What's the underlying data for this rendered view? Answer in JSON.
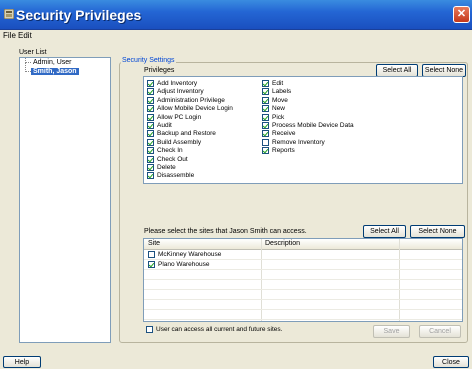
{
  "window": {
    "title": "Security Privileges",
    "close_glyph": "✕"
  },
  "menu": [
    {
      "label": "File",
      "hotkey": "F"
    },
    {
      "label": "Edit",
      "hotkey": "E"
    }
  ],
  "user_list": {
    "label": "User List",
    "users": [
      {
        "name": "Admin, User",
        "selected": false
      },
      {
        "name": "Smith, Jason",
        "selected": true
      }
    ]
  },
  "security_settings": {
    "legend": "Security Settings",
    "privileges_label": "Privileges",
    "select_all": "Select All",
    "select_none": "Select None",
    "privileges_col1": [
      {
        "label": "Add Inventory",
        "checked": true
      },
      {
        "label": "Adjust Inventory",
        "checked": true
      },
      {
        "label": "Administration Privilege",
        "checked": true
      },
      {
        "label": "Allow Mobile Device Login",
        "checked": true
      },
      {
        "label": "Allow PC Login",
        "checked": true
      },
      {
        "label": "Audit",
        "checked": true
      },
      {
        "label": "Backup and Restore",
        "checked": true
      },
      {
        "label": "Build Assembly",
        "checked": true
      },
      {
        "label": "Check In",
        "checked": true
      },
      {
        "label": "Check Out",
        "checked": true
      },
      {
        "label": "Delete",
        "checked": true
      },
      {
        "label": "Disassemble",
        "checked": true
      }
    ],
    "privileges_col2": [
      {
        "label": "Edit",
        "checked": true
      },
      {
        "label": "Labels",
        "checked": true
      },
      {
        "label": "Move",
        "checked": true
      },
      {
        "label": "New",
        "checked": true
      },
      {
        "label": "Pick",
        "checked": true
      },
      {
        "label": "Process Mobile Device Data",
        "checked": true
      },
      {
        "label": "Receive",
        "checked": true
      },
      {
        "label": "Remove Inventory",
        "checked": false
      },
      {
        "label": "Reports",
        "checked": true
      }
    ],
    "sites_prompt": "Please select the sites that Jason Smith can access.",
    "sites_select_all": "Select All",
    "sites_select_none": "Select None",
    "site_columns": [
      "Site",
      "Description"
    ],
    "sites": [
      {
        "name": "McKinney Warehouse",
        "description": "",
        "checked": false
      },
      {
        "name": "Plano Warehouse",
        "description": "",
        "checked": true
      }
    ],
    "future_sites_label": "User can access all current and future sites.",
    "future_sites_checked": false,
    "save": "Save",
    "cancel": "Cancel"
  },
  "footer": {
    "help": "Help",
    "close": "Close"
  },
  "colors": {
    "title_bar": "#2466d4",
    "selection": "#316ac5",
    "legend": "#0046d5",
    "check": "#21a121"
  }
}
